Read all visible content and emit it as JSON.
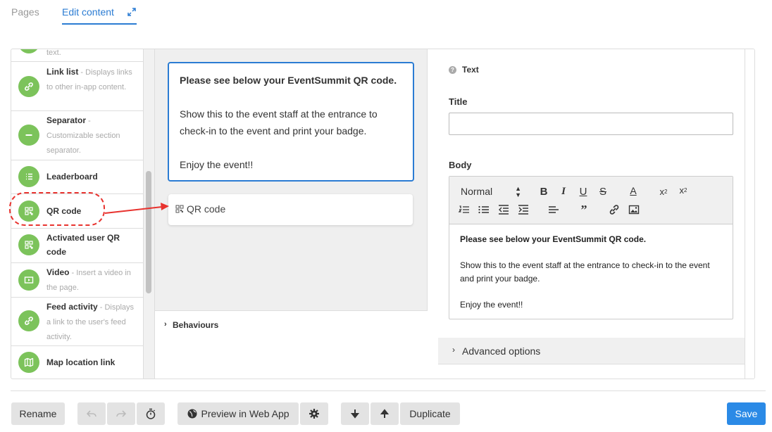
{
  "tabs": {
    "pages": "Pages",
    "edit_content": "Edit content"
  },
  "sidebar": {
    "items": [
      {
        "title": "",
        "desc": "text.",
        "icon": "paragraph-icon"
      },
      {
        "title": "Link list",
        "desc_prefix": " - ",
        "desc": "Displays links to other in-app content.",
        "icon": "link-icon"
      },
      {
        "title": "Separator",
        "desc_prefix": " - ",
        "desc": "Customizable section separator.",
        "icon": "minus-icon"
      },
      {
        "title": "Leaderboard",
        "desc": "",
        "icon": "list-icon"
      },
      {
        "title": "QR code",
        "desc": "",
        "icon": "qr-icon"
      },
      {
        "title": "Activated user QR code",
        "desc": "",
        "icon": "qr-icon"
      },
      {
        "title": "Video",
        "desc_prefix": " - ",
        "desc": "Insert a video in the page.",
        "icon": "video-icon"
      },
      {
        "title": "Feed activity",
        "desc_prefix": " - ",
        "desc": "Displays a link to the user's feed activity.",
        "icon": "link-icon"
      },
      {
        "title": "Map location link",
        "desc": "",
        "icon": "map-icon"
      }
    ]
  },
  "preview": {
    "line1": "Please see below your EventSummit QR code.",
    "line2": "Show this to the event staff at the entrance to check-in to the event and print your badge.",
    "line3": "Enjoy the event!!",
    "qr_label": "QR code",
    "behaviours": "Behaviours"
  },
  "editor": {
    "section_label": "Text",
    "title_label": "Title",
    "title_value": "",
    "body_label": "Body",
    "format_select": "Normal",
    "body_line1": "Please see below your EventSummit QR code.",
    "body_line2": "Show this to the event staff at the entrance to check-in to the event and print your badge.",
    "body_line3": "Enjoy the event!!",
    "advanced": "Advanced options"
  },
  "bottom": {
    "rename": "Rename",
    "preview": "Preview in Web App",
    "duplicate": "Duplicate",
    "save": "Save"
  },
  "colors": {
    "accent": "#2b7cd3",
    "icon_green": "#7cc35b",
    "annotation_red": "#e8332f"
  }
}
